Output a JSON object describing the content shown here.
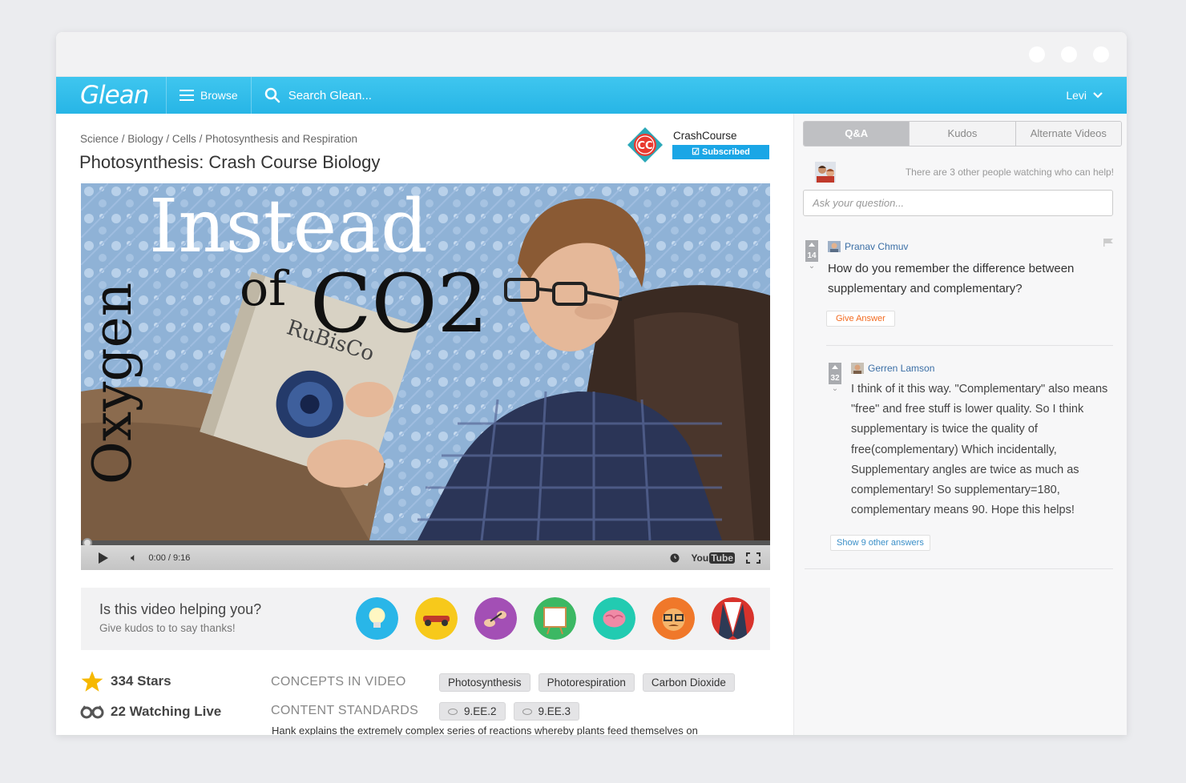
{
  "nav": {
    "logo": "Glean",
    "browse_label": "Browse",
    "search_placeholder": "Search Glean...",
    "user_name": "Levi"
  },
  "video": {
    "breadcrumb": [
      "Science",
      "Biology",
      "Cells",
      "Photosynthesis and Respiration"
    ],
    "title": "Photosynthesis: Crash Course Biology",
    "channel": {
      "name": "CrashCourse",
      "logo_text": "CC",
      "subscribed_label": "Subscribed"
    },
    "overlay": {
      "vertical_text": "Oxygen",
      "word_instead": "Instead",
      "word_of": "of",
      "word_co2": "CO2",
      "book_title": "RuBisCo"
    },
    "player": {
      "current_time": "0:00",
      "duration": "9:16",
      "youtube_you": "You",
      "youtube_tube": "Tube",
      "progress_fraction": 0
    }
  },
  "kudos": {
    "title": "Is this video helping you?",
    "subtitle": "Give kudos to to say thanks!",
    "icons": [
      {
        "name": "lightbulb-icon",
        "color": "#29b6e8"
      },
      {
        "name": "racecar-icon",
        "color": "#f7c91b"
      },
      {
        "name": "hands-icon",
        "color": "#a34fb5"
      },
      {
        "name": "easel-icon",
        "color": "#3cb863"
      },
      {
        "name": "brain-icon",
        "color": "#22cbb1"
      },
      {
        "name": "nerd-face-icon",
        "color": "#f0782a"
      },
      {
        "name": "tuxedo-icon",
        "color": "#d8332c"
      }
    ]
  },
  "stats": {
    "stars": "334 Stars",
    "watching": "22 Watching Live"
  },
  "meta": {
    "concepts_label": "CONCEPTS IN VIDEO",
    "concepts": [
      "Photosynthesis",
      "Photorespiration",
      "Carbon Dioxide"
    ],
    "standards_label": "CONTENT STANDARDS",
    "standards": [
      "9.EE.2",
      "9.EE.3"
    ],
    "description": "Hank explains the extremely complex series of reactions whereby plants feed themselves on"
  },
  "sidebar": {
    "tabs": [
      "Q&A",
      "Kudos",
      "Alternate Videos"
    ],
    "active_tab": "Q&A",
    "watching_text": "There are 3 other people watching who can help!",
    "ask_placeholder": "Ask your question...",
    "question": {
      "author": "Pranav Chmuv",
      "votes": "14",
      "text": "How do you remember the difference between supplementary and complementary?",
      "give_answer_label": "Give Answer"
    },
    "answer": {
      "author": "Gerren Lamson",
      "votes": "32",
      "text": "I think of it this way. \"Complementary\" also means \"free\" and free stuff is lower quality. So I think supplementary is twice the quality of free(complementary) Which incidentally, Supplementary angles are twice as much as complementary! So supplementary=180, complementary means 90. Hope this helps!"
    },
    "show_more_label": "Show 9 other answers"
  },
  "colors": {
    "nav_blue": "#27b5e6",
    "subscribed_blue": "#1aa6e6",
    "give_answer_orange": "#f26b21",
    "link_blue": "#3a6ea5",
    "star_yellow": "#f6b800"
  }
}
